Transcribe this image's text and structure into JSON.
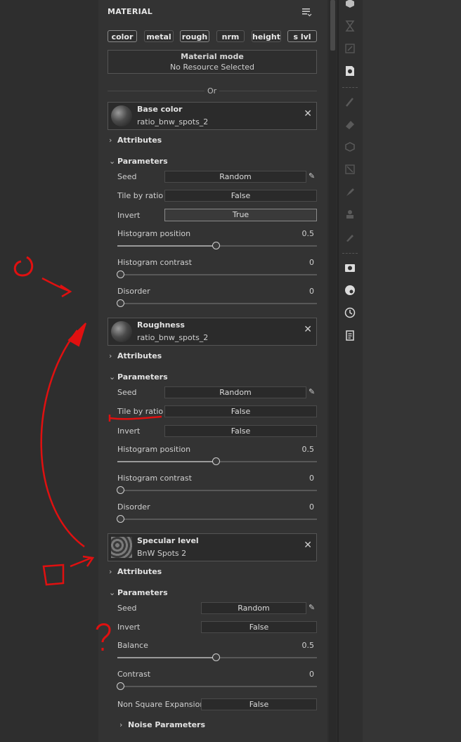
{
  "panel": {
    "title": "MATERIAL",
    "channels": [
      "color",
      "metal",
      "rough",
      "nrm",
      "height",
      "s lvl"
    ],
    "material_mode": {
      "title": "Material mode",
      "status": "No Resource Selected"
    },
    "or_label": "Or"
  },
  "base_color": {
    "title": "Base color",
    "resource": "ratio_bnw_spots_2",
    "attributes_label": "Attributes",
    "parameters_label": "Parameters",
    "seed": {
      "label": "Seed",
      "value": "Random"
    },
    "tile_by_ratio": {
      "label": "Tile by ratio",
      "value": "False"
    },
    "invert": {
      "label": "Invert",
      "value": "True"
    },
    "histogram_position": {
      "label": "Histogram position",
      "value": "0.5",
      "level": 0.5
    },
    "histogram_contrast": {
      "label": "Histogram contrast",
      "value": "0",
      "level": 0
    },
    "disorder": {
      "label": "Disorder",
      "value": "0",
      "level": 0
    }
  },
  "roughness": {
    "title": "Roughness",
    "resource": "ratio_bnw_spots_2",
    "attributes_label": "Attributes",
    "parameters_label": "Parameters",
    "seed": {
      "label": "Seed",
      "value": "Random"
    },
    "tile_by_ratio": {
      "label": "Tile by ratio",
      "value": "False"
    },
    "invert": {
      "label": "Invert",
      "value": "False"
    },
    "histogram_position": {
      "label": "Histogram position",
      "value": "0.5",
      "level": 0.5
    },
    "histogram_contrast": {
      "label": "Histogram contrast",
      "value": "0",
      "level": 0
    },
    "disorder": {
      "label": "Disorder",
      "value": "0",
      "level": 0
    }
  },
  "specular": {
    "title": "Specular level",
    "resource": "BnW Spots 2",
    "attributes_label": "Attributes",
    "parameters_label": "Parameters",
    "seed": {
      "label": "Seed",
      "value": "Random"
    },
    "invert": {
      "label": "Invert",
      "value": "False"
    },
    "balance": {
      "label": "Balance",
      "value": "0.5",
      "level": 0.5
    },
    "contrast": {
      "label": "Contrast",
      "value": "0",
      "level": 0
    },
    "non_square": {
      "label": "Non Square Expansion",
      "value": "False"
    },
    "noise_label": "Noise Parameters"
  },
  "colors": {
    "annotation": "#e01010",
    "background": "#333333",
    "panel_dark": "#2b2b2b"
  }
}
